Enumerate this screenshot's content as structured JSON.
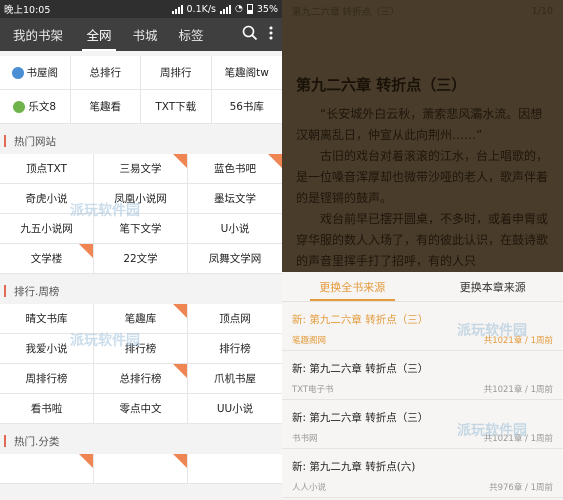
{
  "status_bar": {
    "time": "晚上10:05",
    "speed": "0.1K/s",
    "battery": "35%"
  },
  "nav": {
    "tabs": [
      "我的书架",
      "全网",
      "书城",
      "标签"
    ],
    "active": 1
  },
  "sources": [
    "书屋阁",
    "总排行",
    "周排行",
    "笔趣阁tw",
    "乐文8",
    "笔趣看",
    "TXT下载",
    "56书库"
  ],
  "sections": [
    {
      "title": "热门网站",
      "items": [
        "顶点TXT",
        "三易文学",
        "蓝色书吧",
        "奇虎小说",
        "凤凰小说网",
        "墨坛文学",
        "九五小说网",
        "笔下文学",
        "U小说",
        "文学楼",
        "22文学",
        "凤舞文学网"
      ],
      "ribbons": [
        1,
        2,
        9
      ]
    },
    {
      "title": "排行.周榜",
      "items": [
        "晴文书库",
        "笔趣库",
        "顶点网",
        "我爱小说",
        "排行榜",
        "排行榜",
        "周排行榜",
        "总排行榜",
        "爪机书屋",
        "看书啦",
        "零点中文",
        "UU小说"
      ],
      "ribbons": [
        1,
        7
      ]
    },
    {
      "title": "热门.分类",
      "items": []
    }
  ],
  "reader": {
    "top_left": "第九二六章 转折点（三）",
    "top_right": "1/10",
    "chapter_title": "第九二六章 转折点（三）",
    "paragraphs": [
      "“长安城外白云秋，萧索悲风灞水流。因想汉朝离乱日，仲宣从此向荆州……”",
      "古旧的戏台对着滚滚的江水，台上唱歌的，是一位嗓音浑厚却也微带沙哑的老人，歌声伴着的是铿锵的鼓声。",
      "戏台前早已摆开圆桌，不多时，或着申胄或穿华服的数人入场了，有的彼此认识，在鼓诗歌的声音里挥手打了招呼，有的人只"
    ]
  },
  "source_sheet": {
    "tabs": [
      "更换全书来源",
      "更换本章来源"
    ],
    "active": 0,
    "items": [
      {
        "title": "新: 第九二六章 转折点（三）",
        "site": "笔趣阁网",
        "count": "共1021章 / 1周前",
        "current": true
      },
      {
        "title": "新: 第九二六章 转折点（三）",
        "site": "TXT电子书",
        "count": "共1021章 / 1周前",
        "current": false
      },
      {
        "title": "新: 第九二六章 转折点（三）",
        "site": "书书网",
        "count": "共1021章 / 1周前",
        "current": false
      },
      {
        "title": "新: 第九二九章 转折点(六)",
        "site": "人人小说",
        "count": "共976章 / 1周前",
        "current": false
      }
    ]
  },
  "watermark": "派玩软件园"
}
